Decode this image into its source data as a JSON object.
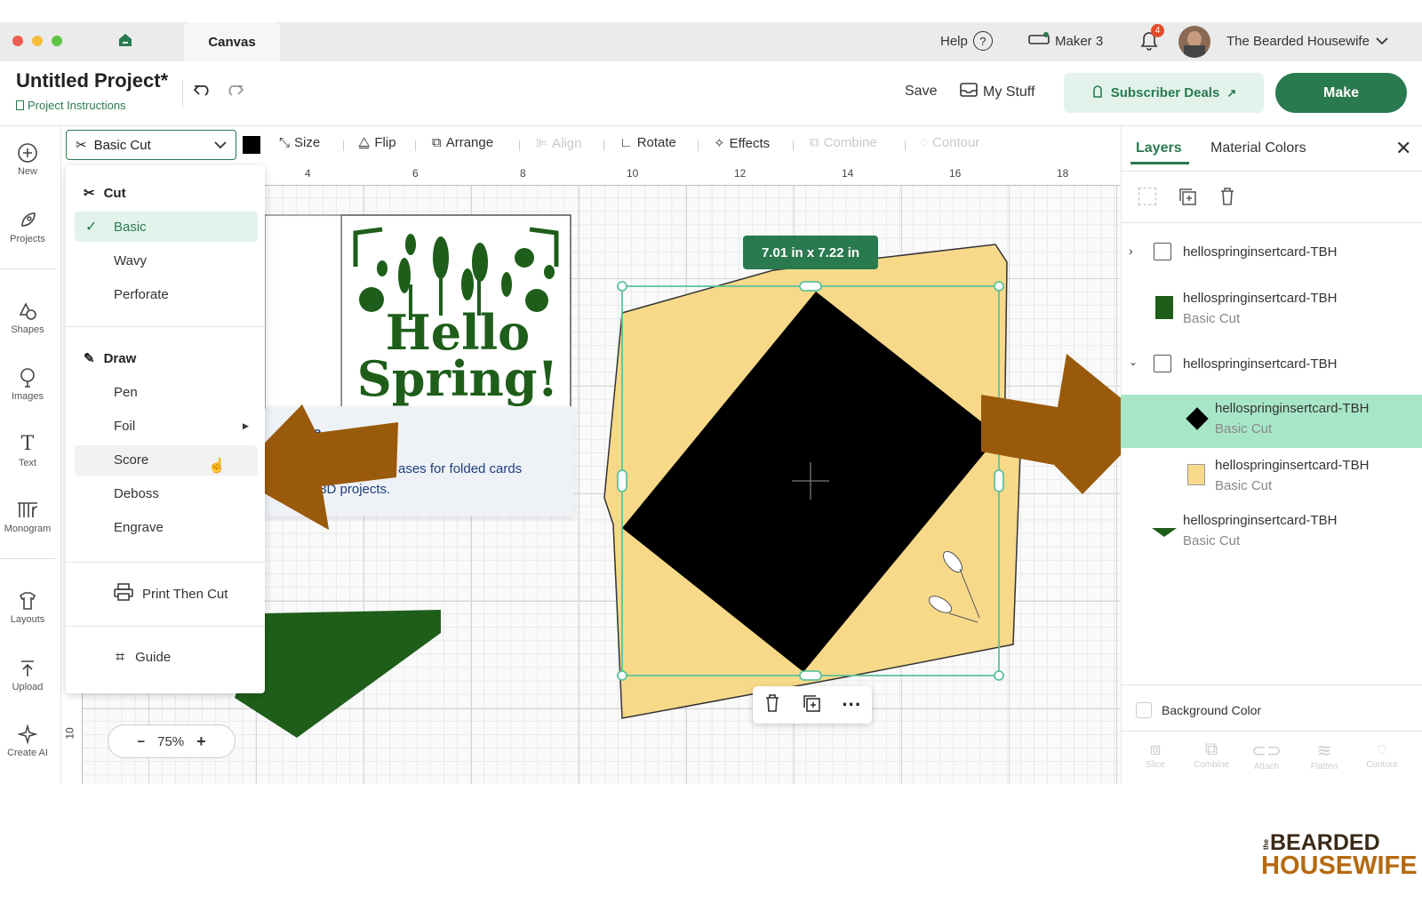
{
  "titlebar": {
    "tab_label": "Canvas",
    "help_label": "Help",
    "machine_label": "Maker 3",
    "notification_count": "4",
    "user_name": "The Bearded Housewife"
  },
  "project": {
    "title": "Untitled Project*",
    "instructions_link": "Project Instructions",
    "save_label": "Save",
    "mystuff_label": "My Stuff",
    "deals_label": "Subscriber Deals",
    "make_label": "Make"
  },
  "toolbar": {
    "operation_value": "Basic Cut",
    "size_label": "Size",
    "flip_label": "Flip",
    "arrange_label": "Arrange",
    "align_label": "Align",
    "rotate_label": "Rotate",
    "effects_label": "Effects",
    "combine_label": "Combine",
    "contour_label": "Contour"
  },
  "leftrail": {
    "items": [
      {
        "label": "New"
      },
      {
        "label": "Projects"
      },
      {
        "label": "Shapes"
      },
      {
        "label": "Images"
      },
      {
        "label": "Text"
      },
      {
        "label": "Monogram"
      },
      {
        "label": "Layouts"
      },
      {
        "label": "Upload"
      },
      {
        "label": "Create AI"
      }
    ]
  },
  "rulers": {
    "top_ticks": [
      "4",
      "6",
      "8",
      "10",
      "12",
      "14",
      "16",
      "18"
    ],
    "left_ticks": [
      "10"
    ]
  },
  "dropdown": {
    "cut_heading": "Cut",
    "cut_options": [
      "Basic",
      "Wavy",
      "Perforate"
    ],
    "draw_heading": "Draw",
    "draw_options": [
      "Pen",
      "Foil",
      "Score",
      "Deboss",
      "Engrave"
    ],
    "print_then_cut": "Print Then Cut",
    "guide": "Guide"
  },
  "tooltip": {
    "title_fragment": "ore",
    "line1": "ases for folded cards",
    "line2": "and 3D projects."
  },
  "card_art": {
    "line1": "Hello",
    "line2": "Spring!"
  },
  "selection": {
    "dimensions": "7.01  in x 7.22  in"
  },
  "zoom": {
    "minus": "−",
    "value": "75%",
    "plus": "+"
  },
  "panel": {
    "tab_layers": "Layers",
    "tab_material": "Material Colors",
    "layers": [
      {
        "name": "hellospringinsertcard-TBH",
        "sub": ""
      },
      {
        "name": "hellospringinsertcard-TBH",
        "sub": "Basic Cut"
      },
      {
        "name": "hellospringinsertcard-TBH",
        "sub": ""
      },
      {
        "name": "hellospringinsertcard-TBH",
        "sub": "Basic Cut"
      },
      {
        "name": "hellospringinsertcard-TBH",
        "sub": "Basic Cut"
      },
      {
        "name": "hellospringinsertcard-TBH",
        "sub": "Basic Cut"
      }
    ],
    "background_color_label": "Background Color",
    "bottom_actions": [
      "Slice",
      "Combine",
      "Attach",
      "Flatten",
      "Contour"
    ]
  },
  "watermark": {
    "small": "the",
    "line1": "BEARDED",
    "line2": "HOUSEWIFE"
  },
  "colors": {
    "brand_green": "#2a7a4f",
    "selected_row": "#a8e6c8",
    "envelope_yellow": "#f8d98a",
    "leaf_green": "#1e5e1a",
    "arrow_brown": "#9a5a0b"
  }
}
